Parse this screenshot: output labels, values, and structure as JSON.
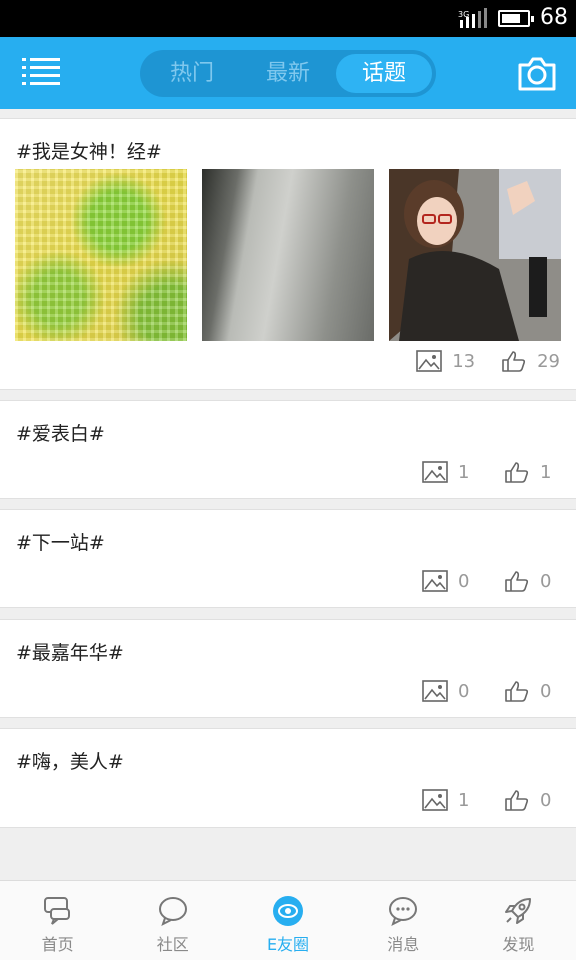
{
  "status_bar": {
    "network": "3G",
    "battery_level": "68"
  },
  "header": {
    "tabs": [
      {
        "label": "热门",
        "selected": false
      },
      {
        "label": "最新",
        "selected": false
      },
      {
        "label": "话题",
        "selected": true
      }
    ],
    "menu_icon": "menu-icon",
    "camera_icon": "camera-icon",
    "accent_color": "#27aef0"
  },
  "topics": [
    {
      "title": "#我是女神！经#",
      "image_count": "13",
      "like_count": "29",
      "thumbnails": [
        "yellow-green-mosaic",
        "gray-blur",
        "anime-girl-glasses"
      ]
    },
    {
      "title": "#爱表白#",
      "image_count": "1",
      "like_count": "1"
    },
    {
      "title": "#下一站#",
      "image_count": "0",
      "like_count": "0"
    },
    {
      "title": "#最嘉年华#",
      "image_count": "0",
      "like_count": "0"
    },
    {
      "title": "#嗨，美人#",
      "image_count": "1",
      "like_count": "0"
    }
  ],
  "bottom_nav": [
    {
      "label": "首页",
      "icon": "home-chat-icon",
      "active": false
    },
    {
      "label": "社区",
      "icon": "chat-bubble-icon",
      "active": false
    },
    {
      "label": "E友圈",
      "icon": "eye-circle-icon",
      "active": true
    },
    {
      "label": "消息",
      "icon": "message-dots-icon",
      "active": false
    },
    {
      "label": "发现",
      "icon": "rocket-icon",
      "active": false
    }
  ]
}
